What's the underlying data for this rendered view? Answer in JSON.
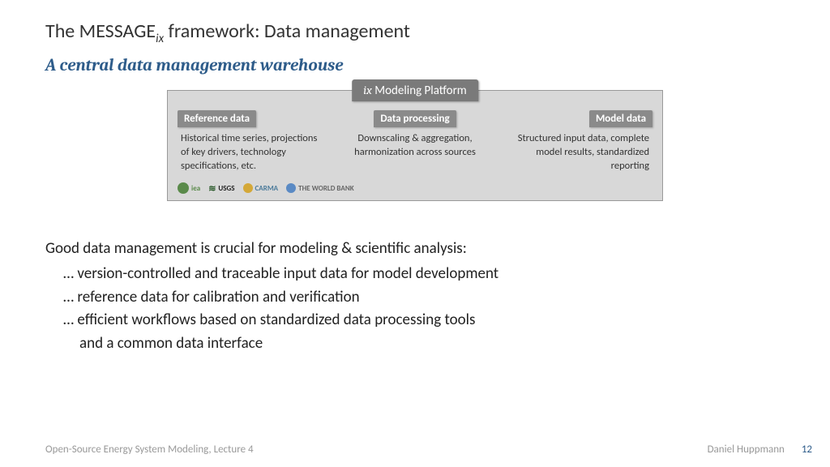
{
  "title_pre": "The MESSAGE",
  "title_sub": "ix",
  "title_post": " framework: Data management",
  "subtitle": "A central data management warehouse",
  "diagram": {
    "platform_pre": "ix",
    "platform_post": " Modeling Platform",
    "col1_head": "Reference data",
    "col1_body": "Historical time series, projections of key drivers, technology specifications, etc.",
    "col2_head": "Data processing",
    "col2_body": "Downscaling & aggregation, harmonization across sources",
    "col3_head": "Model data",
    "col3_body": "Structured input data, complete model results, standardized reporting",
    "logo1": "iea",
    "logo2": "USGS",
    "logo3": "CARMA",
    "logo4": "THE WORLD BANK"
  },
  "lead": "Good data management is crucial for modeling & scientific analysis:",
  "b1": "… version-controlled and traceable input data for model development",
  "b2": "… reference data for calibration and verification",
  "b3a": "… efficient workflows based on standardized data processing tools",
  "b3b": "and a common data interface",
  "footer_left": "Open-Source Energy System Modeling, Lecture 4",
  "footer_author": "Daniel Huppmann",
  "footer_page": "12"
}
